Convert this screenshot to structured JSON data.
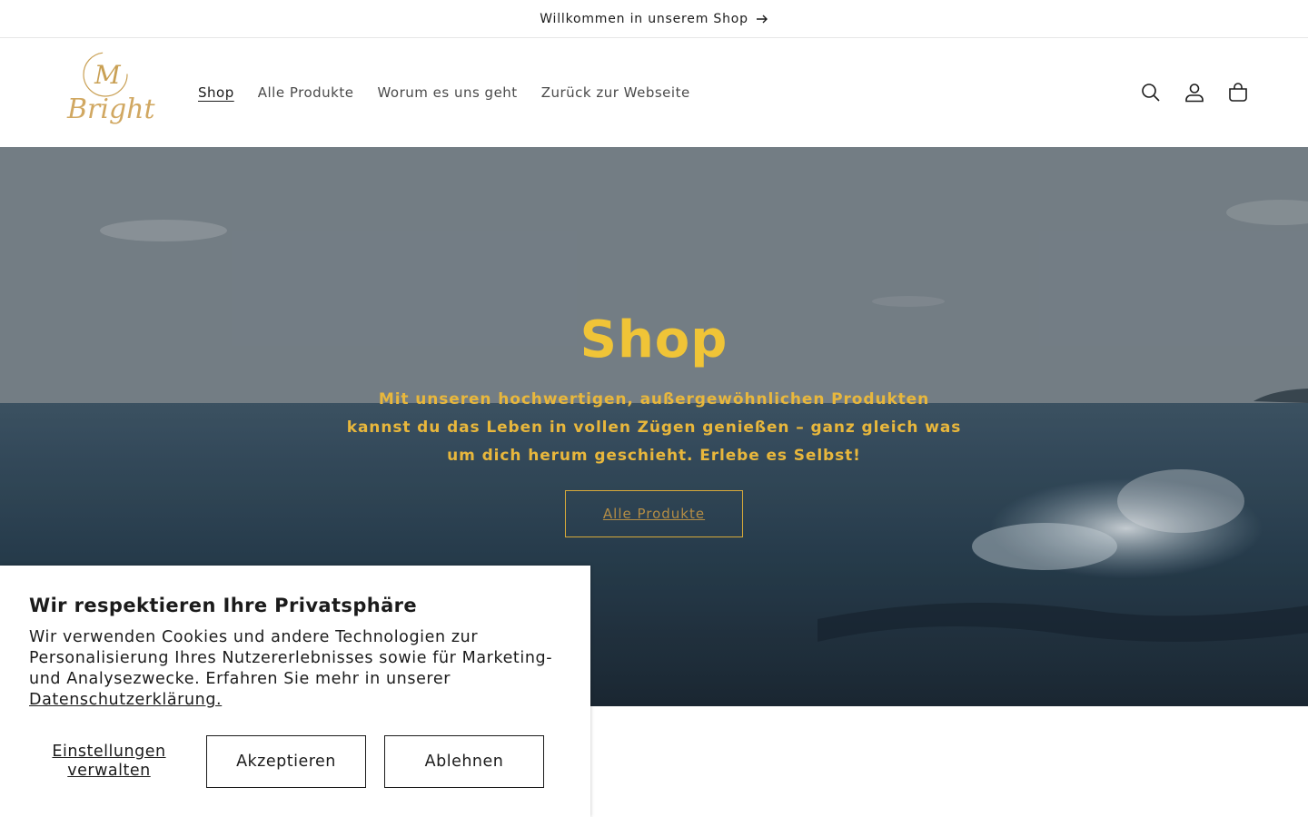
{
  "announcement": {
    "text": "Willkommen in unserem Shop",
    "icon": "arrow-right-icon"
  },
  "header": {
    "logo": {
      "text": "Bright",
      "monogram": "M",
      "color": "#c9a054"
    },
    "nav": [
      {
        "label": "Shop",
        "active": true
      },
      {
        "label": "Alle Produkte"
      },
      {
        "label": "Worum es uns geht"
      },
      {
        "label": "Zurück zur Webseite"
      }
    ],
    "icons": [
      "search-icon",
      "account-icon",
      "cart-icon"
    ]
  },
  "hero": {
    "title": "Shop",
    "text": "Mit unseren hochwertigen, außergewöhnlichen Produkten kannst du das Leben in vollen Zügen genießen – ganz gleich was um dich herum geschieht. Erlebe es Selbst!",
    "button_label": "Alle Produkte",
    "accent": "#f0c437"
  },
  "cookie": {
    "title": "Wir respektieren Ihre Privatsphäre",
    "text": "Wir verwenden Cookies und andere Technologien zur Personalisierung Ihres Nutzererlebnisses sowie für Marketing- und Analysezwecke. Erfahren Sie mehr in unserer",
    "link_label": "Datenschutzerklärung.",
    "manage_label": "Einstellungen verwalten",
    "accept_label": "Akzeptieren",
    "decline_label": "Ablehnen"
  }
}
